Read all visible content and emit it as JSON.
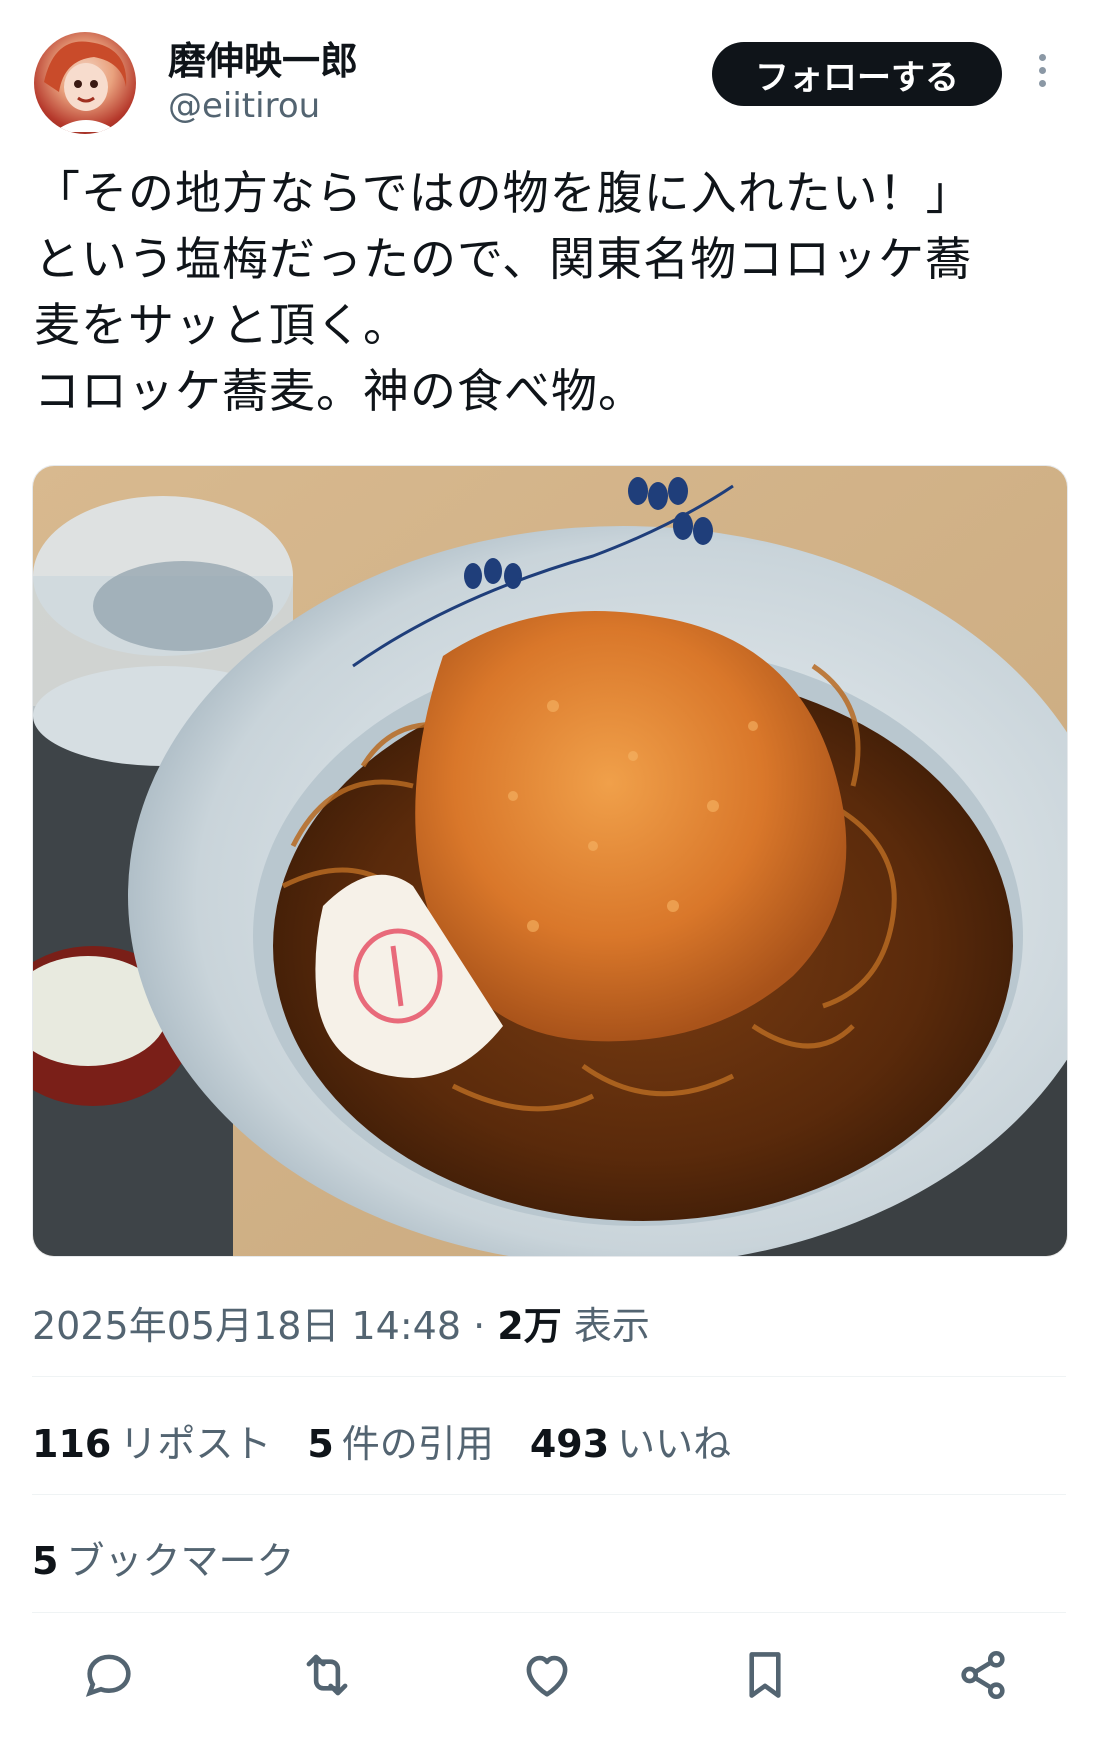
{
  "author": {
    "display_name": "磨伸映一郎",
    "handle": "@eiitirou",
    "avatar_icon": "avatar-image"
  },
  "follow_button": {
    "label": "フォローする"
  },
  "more_icon": "more-vertical-icon",
  "tweet": {
    "text": "「その地方ならではの物を腹に入れたい！」\nという塩梅だったので、関東名物コロッケ蕎\n麦をサッと頂く。\nコロッケ蕎麦。神の食べ物。"
  },
  "meta": {
    "timestamp": "2025年05月18日 14:48",
    "separator": "·",
    "views_count": "2万",
    "views_label": "表示"
  },
  "stats": {
    "reposts_count": "116",
    "reposts_label": "リポスト",
    "quotes_count": "5",
    "quotes_label": "件の引用",
    "likes_count": "493",
    "likes_label": "いいね"
  },
  "bookmarks": {
    "count": "5",
    "label": "ブックマーク"
  },
  "action_bar": [
    "reply-icon",
    "repost-icon",
    "like-icon",
    "bookmark-icon",
    "share-icon"
  ],
  "colors": {
    "primary_text": "#0f1419",
    "secondary_text": "#536471",
    "divider": "#eff3f4",
    "button_bg": "#0f1419"
  }
}
